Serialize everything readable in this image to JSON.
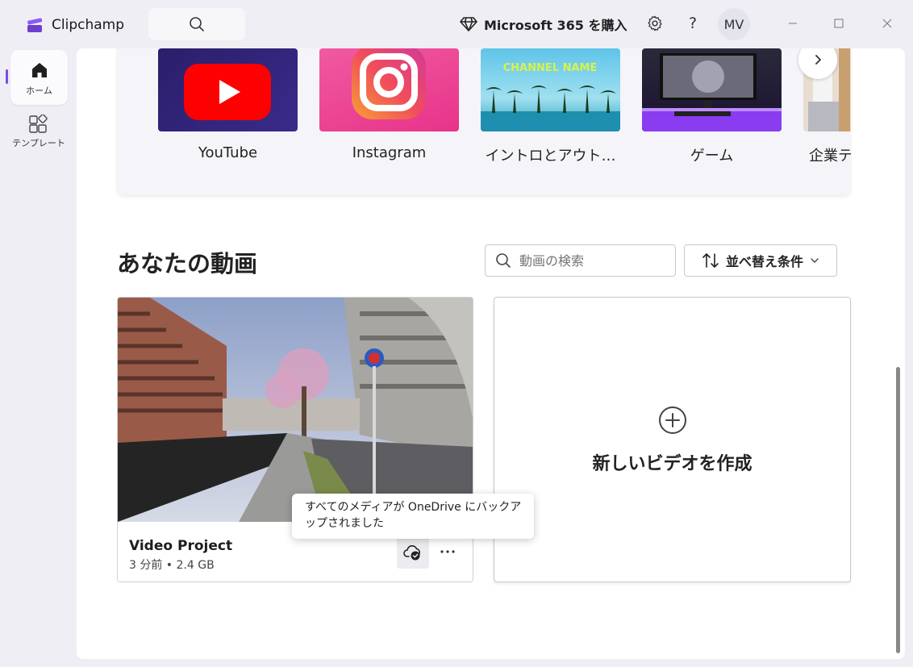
{
  "app": {
    "name": "Clipchamp"
  },
  "header": {
    "ms365_label": "Microsoft 365 を購入",
    "avatar_initials": "MV"
  },
  "sidebar": {
    "items": [
      {
        "label": "ホーム",
        "icon": "home-icon",
        "active": true
      },
      {
        "label": "テンプレート",
        "icon": "templates-icon",
        "active": false
      }
    ]
  },
  "templates": {
    "items": [
      {
        "label": "YouTube"
      },
      {
        "label": "Instagram"
      },
      {
        "label": "イントロとアウト…",
        "thumb_text": "CHANNEL NAME"
      },
      {
        "label": "ゲーム"
      },
      {
        "label": "企業テ"
      }
    ]
  },
  "videos": {
    "title": "あなたの動画",
    "search_placeholder": "動画の検索",
    "sort_label": "並べ替え条件",
    "projects": [
      {
        "title": "Video Project",
        "meta": "3 分前 • 2.4 GB"
      }
    ],
    "create_label": "新しいビデオを作成"
  },
  "tooltip": {
    "text": "すべてのメディアが OneDrive にバックアップされました"
  },
  "colors": {
    "accent": "#7b4fe0",
    "youtube_red": "#ff0000"
  }
}
